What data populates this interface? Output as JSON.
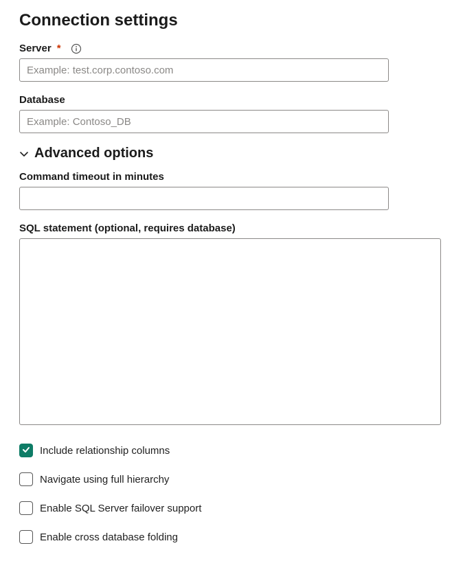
{
  "title": "Connection settings",
  "fields": {
    "server": {
      "label": "Server",
      "required_marker": "*",
      "placeholder": "Example: test.corp.contoso.com",
      "value": ""
    },
    "database": {
      "label": "Database",
      "placeholder": "Example: Contoso_DB",
      "value": ""
    }
  },
  "advanced": {
    "title": "Advanced options",
    "timeout": {
      "label": "Command timeout in minutes",
      "value": ""
    },
    "sql": {
      "label": "SQL statement (optional, requires database)",
      "value": ""
    },
    "checkboxes": [
      {
        "label": "Include relationship columns",
        "checked": true
      },
      {
        "label": "Navigate using full hierarchy",
        "checked": false
      },
      {
        "label": "Enable SQL Server failover support",
        "checked": false
      },
      {
        "label": "Enable cross database folding",
        "checked": false
      }
    ]
  },
  "colors": {
    "accent": "#0e7c66",
    "border": "#8a8886",
    "required": "#cc3300"
  }
}
